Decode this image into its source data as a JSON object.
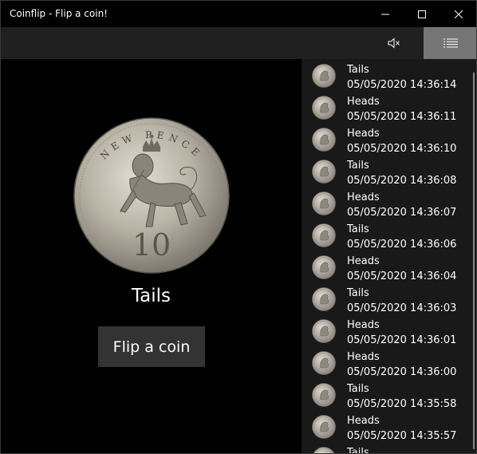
{
  "window": {
    "title": "Coinflip - Flip a coin!"
  },
  "titlebar_buttons": {
    "minimize": "minimize-icon",
    "maximize": "maximize-icon",
    "close": "close-icon"
  },
  "command_bar": {
    "mute_icon": "speaker-muted-icon",
    "history_icon": "list-icon"
  },
  "main": {
    "coin_face": "tails",
    "coin_text": {
      "legend": "NEW PENCE",
      "denomination": "10"
    },
    "result": "Tails",
    "flip_button": "Flip a coin"
  },
  "history": [
    {
      "result": "Tails",
      "time": "05/05/2020 14:36:14"
    },
    {
      "result": "Heads",
      "time": "05/05/2020 14:36:11"
    },
    {
      "result": "Heads",
      "time": "05/05/2020 14:36:10"
    },
    {
      "result": "Tails",
      "time": "05/05/2020 14:36:08"
    },
    {
      "result": "Heads",
      "time": "05/05/2020 14:36:07"
    },
    {
      "result": "Tails",
      "time": "05/05/2020 14:36:06"
    },
    {
      "result": "Heads",
      "time": "05/05/2020 14:36:04"
    },
    {
      "result": "Tails",
      "time": "05/05/2020 14:36:03"
    },
    {
      "result": "Heads",
      "time": "05/05/2020 14:36:01"
    },
    {
      "result": "Heads",
      "time": "05/05/2020 14:36:00"
    },
    {
      "result": "Tails",
      "time": "05/05/2020 14:35:58"
    },
    {
      "result": "Heads",
      "time": "05/05/2020 14:35:57"
    },
    {
      "result": "Tails",
      "time": ""
    }
  ],
  "colors": {
    "titlebar": "#000000",
    "command_bar": "#202020",
    "selected_button": "#767676",
    "history_bg": "#191919",
    "flip_button_bg": "#333333"
  }
}
